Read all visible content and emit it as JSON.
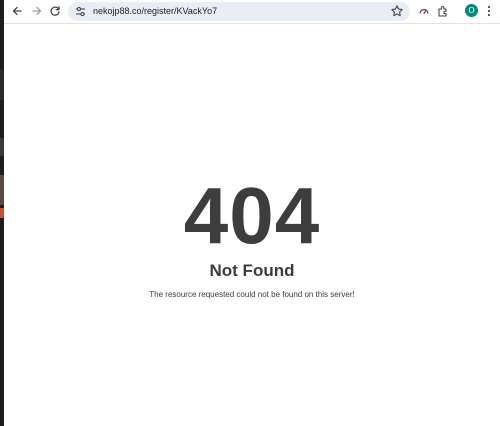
{
  "browser": {
    "url": "nekojp88.co/register/KVackYo7",
    "profile_initial": "O",
    "accent_color": "#00897b"
  },
  "page": {
    "code": "404",
    "title": "Not Found",
    "message": "The resource requested could not be found on this server!"
  },
  "colors": {
    "text": "#3d3d3d",
    "omnibox_bg": "#e9eef6",
    "background": "#ffffff"
  },
  "icons": [
    "back-arrow-icon",
    "forward-arrow-icon",
    "reload-icon",
    "tune-icon",
    "star-icon",
    "performance-icon",
    "extensions-icon",
    "menu-kebab-icon"
  ]
}
